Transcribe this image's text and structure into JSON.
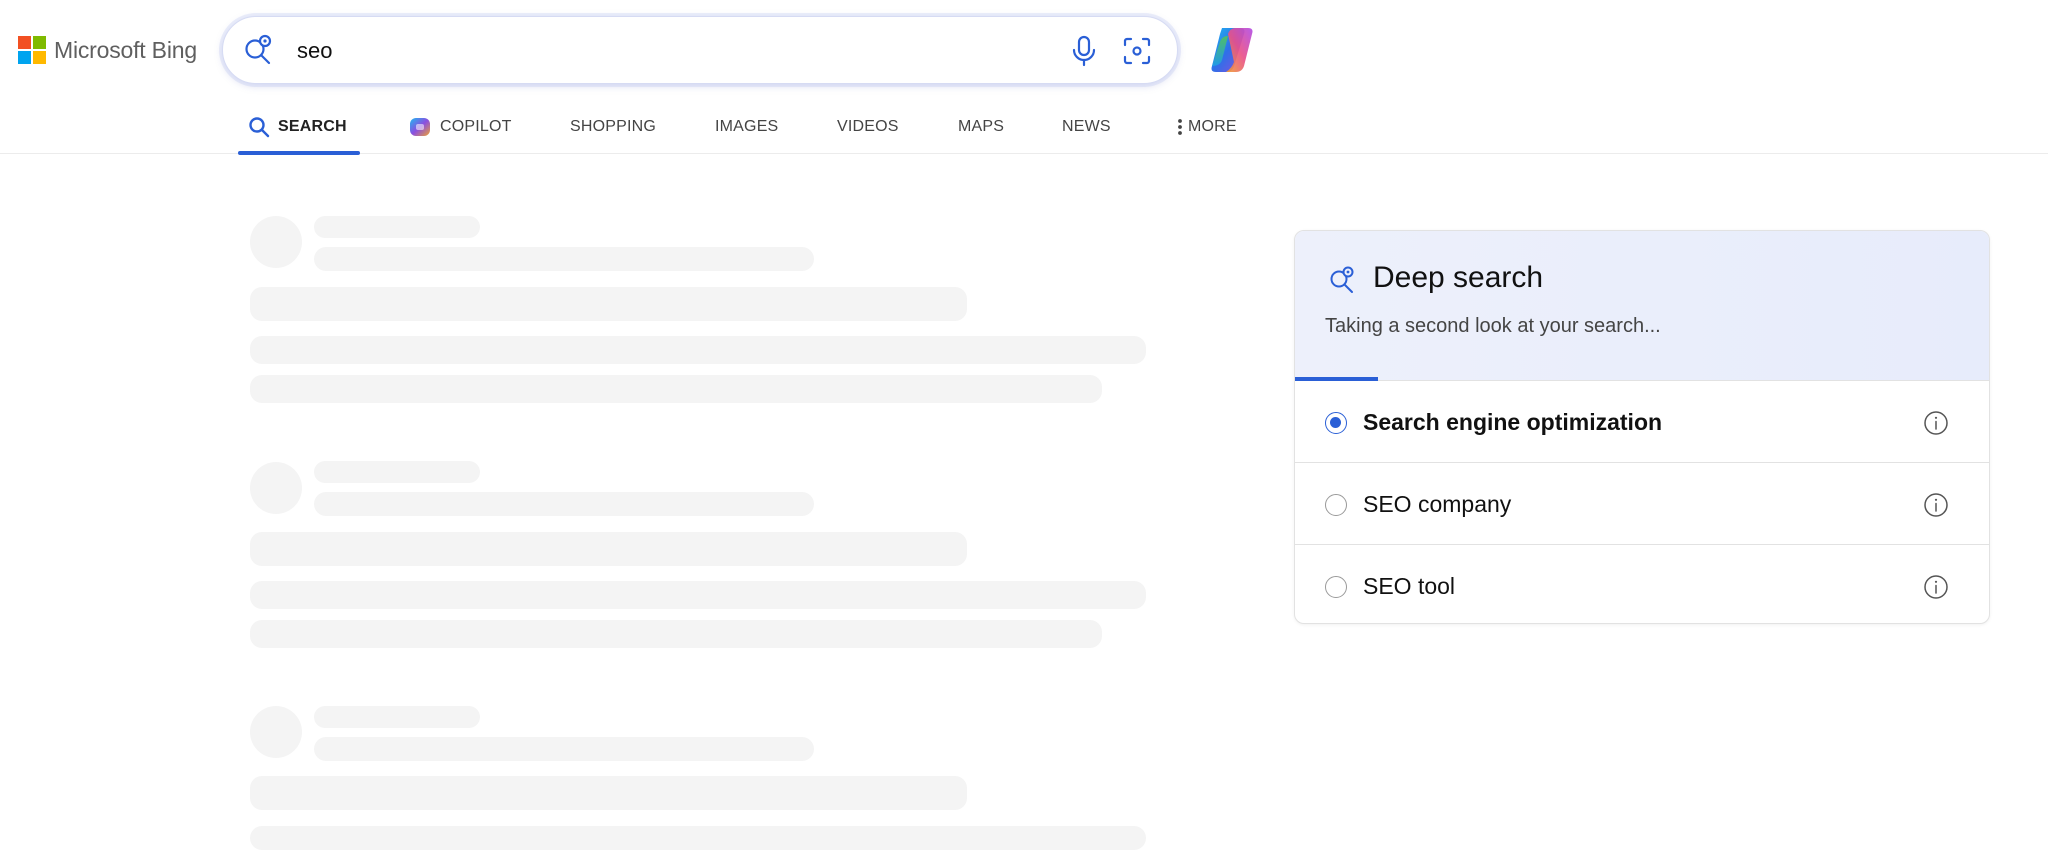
{
  "brand": {
    "name": "Microsoft Bing",
    "logo_colors": [
      "#f25022",
      "#7fba00",
      "#00a4ef",
      "#ffb900"
    ]
  },
  "search": {
    "query": "seo",
    "icon": "deep-search-icon",
    "mic_icon": "microphone-icon",
    "visual_icon": "visual-search-icon"
  },
  "copilot_button": {
    "icon": "copilot-icon"
  },
  "nav": {
    "tabs": [
      {
        "label": "SEARCH",
        "icon": "search-icon",
        "active": true
      },
      {
        "label": "COPILOT",
        "icon": "copilot-icon",
        "active": false
      },
      {
        "label": "SHOPPING",
        "active": false
      },
      {
        "label": "IMAGES",
        "active": false
      },
      {
        "label": "VIDEOS",
        "active": false
      },
      {
        "label": "MAPS",
        "active": false
      },
      {
        "label": "NEWS",
        "active": false
      },
      {
        "label": "MORE",
        "icon": "more-vertical-icon",
        "active": false
      }
    ]
  },
  "deep_search": {
    "title": "Deep search",
    "subtitle": "Taking a second look at your search...",
    "progress": 0.12,
    "options": [
      {
        "label": "Search engine optimization",
        "selected": true,
        "info_icon": "info-icon"
      },
      {
        "label": "SEO company",
        "selected": false,
        "info_icon": "info-icon"
      },
      {
        "label": "SEO tool",
        "selected": false,
        "info_icon": "info-icon"
      }
    ]
  },
  "colors": {
    "accent": "#2a5fd6",
    "skeleton": "#f4f4f4",
    "panel_header": "#eaeefb"
  }
}
